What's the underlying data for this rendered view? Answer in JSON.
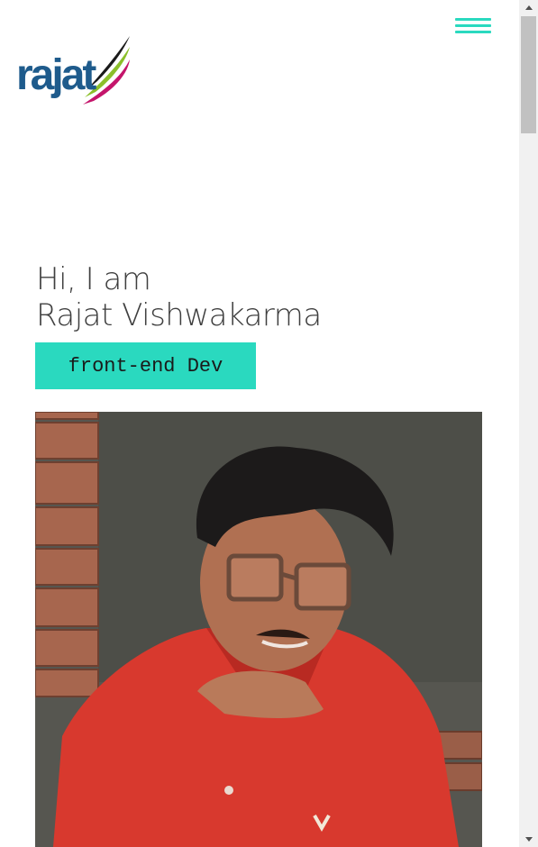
{
  "header": {
    "logo_text": "rajat",
    "menu_icon": "hamburger-menu-icon"
  },
  "hero": {
    "greeting_line1": "Hi, I am",
    "greeting_line2": "Rajat Vishwakarma",
    "role": "front-end Dev"
  },
  "colors": {
    "accent": "#2ad9bf",
    "logo_blue": "#1e5b8c",
    "logo_swoosh_green": "#8bbf2a",
    "logo_swoosh_magenta": "#c4156b",
    "text": "#3f3f3f"
  }
}
